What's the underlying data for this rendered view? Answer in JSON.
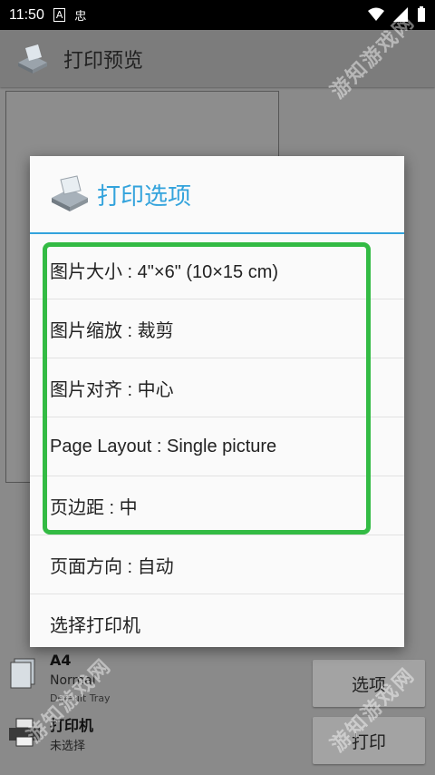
{
  "status_bar": {
    "time": "11:50",
    "notif_a": "A",
    "notif_b": "忠"
  },
  "app_bar": {
    "title": "打印预览"
  },
  "bottom": {
    "paper": {
      "size": "A4",
      "type": "Normal",
      "tray": "Default Tray"
    },
    "printer": {
      "label": "打印机",
      "value": "未选择"
    },
    "options_button": "选项",
    "print_button": "打印"
  },
  "dialog": {
    "title": "打印选项",
    "options": [
      "图片大小 : 4\"×6\" (10×15 cm)",
      "图片缩放 : 裁剪",
      "图片对齐 : 中心",
      "Page Layout : Single picture",
      "页边距 : 中",
      "页面方向 : 自动",
      "选择打印机"
    ]
  },
  "watermark": "游知游戏网",
  "colors": {
    "accent": "#33a3dc",
    "highlight": "#33bb44"
  }
}
